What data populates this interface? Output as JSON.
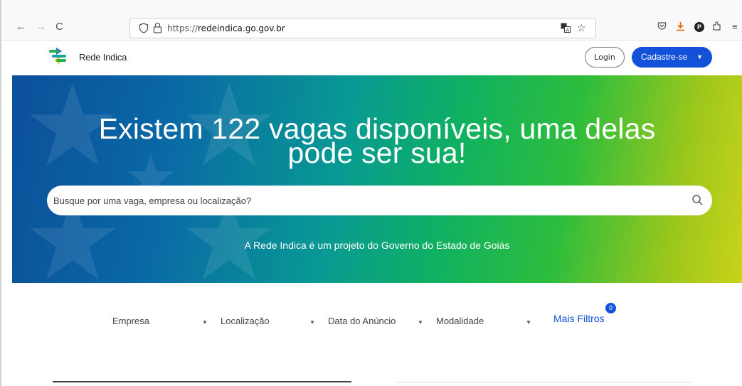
{
  "browser": {
    "url_prefix": "https://",
    "url_domain": "redeindica.go.gov.br",
    "back_icon": "←",
    "forward_icon": "→",
    "reload_icon": "C",
    "menu_icon": "≡"
  },
  "header": {
    "brand": "Rede Indica",
    "login_label": "Login",
    "signup_label": "Cadastre-se"
  },
  "hero": {
    "title_line1": "Existem 122 vagas disponíveis, uma delas",
    "title_line2": "pode ser sua!",
    "search_placeholder": "Busque por uma vaga, empresa ou localização?",
    "subtitle": "A Rede Indica é um projeto do Governo do Estado de Goiás"
  },
  "filters": {
    "items": [
      {
        "label": "Empresa"
      },
      {
        "label": "Localização"
      },
      {
        "label": "Data do Anúncio"
      },
      {
        "label": "Modalidade"
      }
    ],
    "more_label": "Mais Filtros",
    "badge_count": "0"
  },
  "colors": {
    "primary": "#1351d8",
    "hero_start": "#0b4f9a",
    "hero_end": "#c9d31a"
  }
}
